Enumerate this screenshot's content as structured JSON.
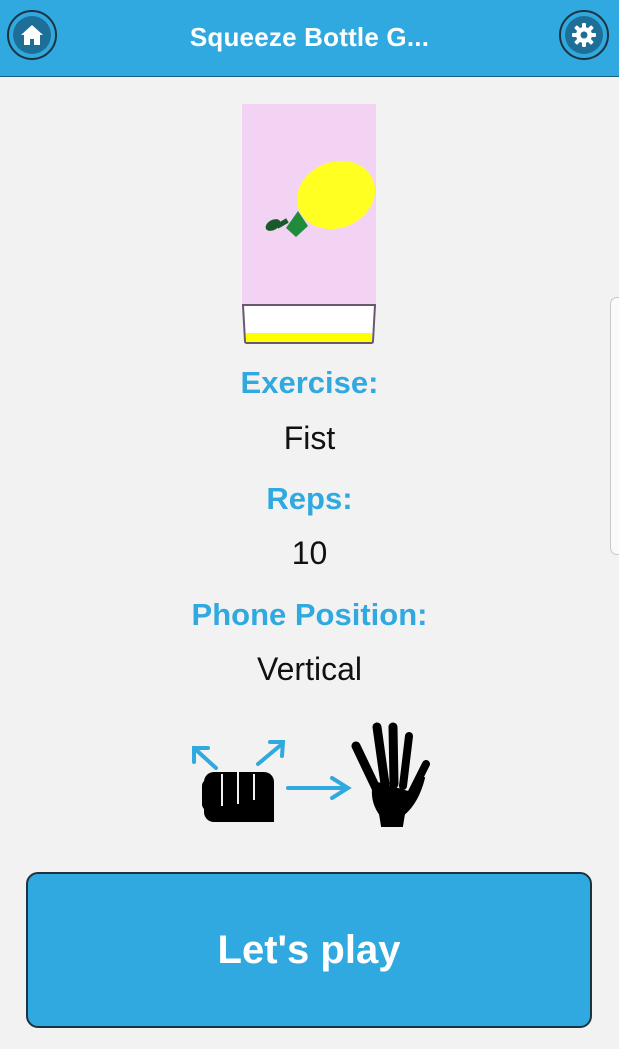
{
  "header": {
    "title": "Squeeze Bottle G...",
    "home_icon": "home-icon",
    "settings_icon": "gear-icon"
  },
  "exercise": {
    "label": "Exercise:",
    "value": "Fist"
  },
  "reps": {
    "label": "Reps:",
    "value": "10"
  },
  "phone_position": {
    "label": "Phone Position:",
    "value": "Vertical"
  },
  "gesture_illustration": {
    "icons": [
      "fist-icon",
      "expand-arrows-icon",
      "right-arrow-icon",
      "open-hand-icon"
    ]
  },
  "play_button": {
    "label": "Let's play"
  },
  "colors": {
    "accent": "#2fa9df",
    "preview_background": "#f3d3f3",
    "bottle": "#ffff22",
    "bottle_cap": "#1f8c3c",
    "glass_fill": "#ffff00"
  }
}
